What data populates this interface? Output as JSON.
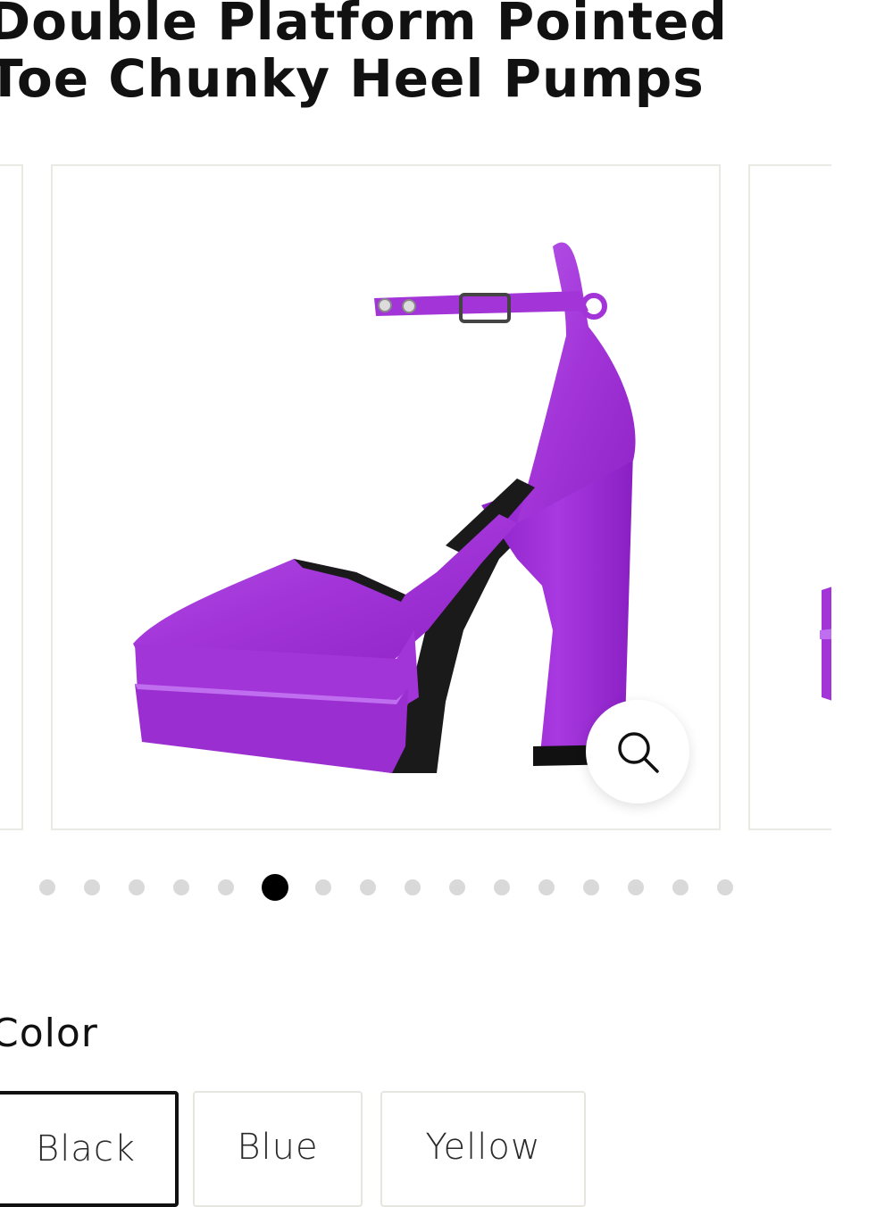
{
  "product": {
    "title": "Double Platform Pointed Toe Chunky Heel Pumps"
  },
  "gallery": {
    "zoom_icon": "search-icon",
    "total_slides": 16,
    "current_slide": 6
  },
  "options": {
    "color_label": "Color",
    "colors": [
      {
        "label": "Black",
        "selected": true
      },
      {
        "label": "Blue",
        "selected": false
      },
      {
        "label": "Yellow",
        "selected": false
      }
    ]
  },
  "colors": {
    "shoe_purple": "#a234d8",
    "border": "#ebe9e3",
    "dot_inactive": "#d9d9d9",
    "dot_active": "#000000"
  }
}
